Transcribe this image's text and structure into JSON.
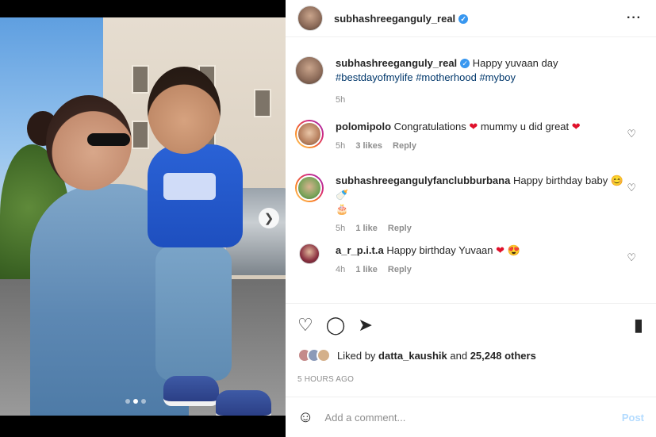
{
  "post": {
    "username": "subhashreeganguly_real",
    "caption": {
      "text": "Happy yuvaan day",
      "hashtags": [
        "#bestdayofmylife",
        "#motherhood",
        "#myboy"
      ],
      "time": "5h"
    }
  },
  "comments": [
    {
      "user": "polomipolo",
      "text": "Congratulations",
      "text2": "mummy u did great",
      "time": "5h",
      "likes": "3 likes",
      "reply": "Reply"
    },
    {
      "user": "subhashreegangulyfanclubburbana",
      "text": "Happy birthday baby",
      "time": "5h",
      "likes": "1 like",
      "reply": "Reply"
    },
    {
      "user": "a_r_p.i.t.a",
      "text": "Happy birthday Yuvaan",
      "time": "4h",
      "likes": "1 like",
      "reply": "Reply"
    }
  ],
  "liked_by": {
    "prefix": "Liked by",
    "user": "datta_kaushik",
    "middle": "and",
    "count": "25,248 others"
  },
  "time_ago": "5 HOURS AGO",
  "add_comment": {
    "placeholder": "Add a comment...",
    "post_label": "Post"
  },
  "carousel": {
    "slide_count": 3,
    "current_slide": 2
  },
  "icons": [
    "more-icon",
    "heart-icon",
    "comment-icon",
    "share-icon",
    "save-icon",
    "emoji-icon",
    "verified-icon",
    "next-arrow-icon"
  ],
  "colors": {
    "link": "#00376b",
    "verified": "#3897f0",
    "post_disabled": "#b3dbff",
    "heart": "#e0112b"
  }
}
